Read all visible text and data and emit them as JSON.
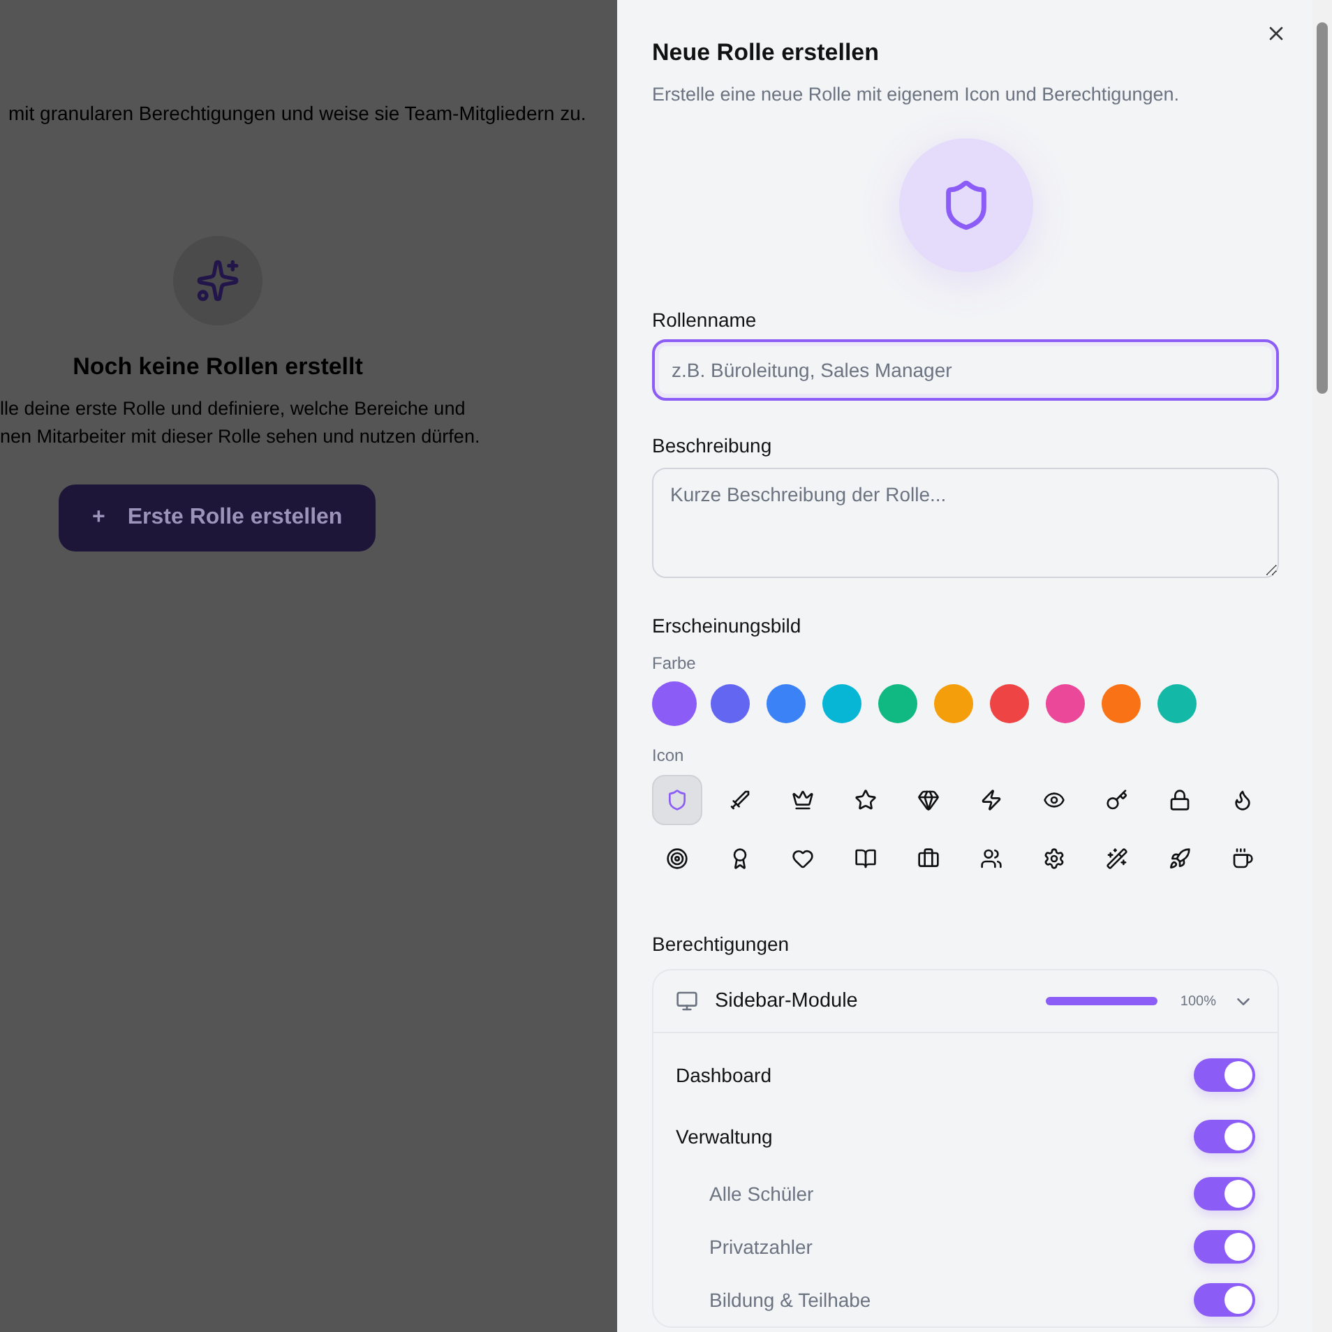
{
  "background_page": {
    "intro": "mit granularen Berechtigungen und weise sie Team-Mitgliedern zu.",
    "empty_state": {
      "title": "Noch keine Rollen erstellt",
      "text_lines": [
        "lle deine erste Rolle und definiere, welche Bereiche und",
        "nen Mitarbeiter mit dieser Rolle sehen und nutzen dürfen."
      ],
      "button": {
        "icon_text": "+",
        "label": "Erste Rolle erstellen"
      }
    }
  },
  "dialog": {
    "title": "Neue Rolle erstellen",
    "subtitle": "Erstelle eine neue Rolle mit eigenem Icon und Berechtigungen.",
    "name_field": {
      "label": "Rollenname",
      "placeholder": "z.B. Büroleitung, Sales Manager",
      "focused": true
    },
    "description_field": {
      "label": "Beschreibung",
      "placeholder": "Kurze Beschreibung der Rolle..."
    },
    "appearance": {
      "title": "Erscheinungsbild",
      "color_label": "Farbe",
      "colors": [
        {
          "color": "#8b5cf6",
          "selected": true
        },
        {
          "color": "#6366f1",
          "selected": false
        },
        {
          "color": "#3b82f6",
          "selected": false
        },
        {
          "color": "#06b6d4",
          "selected": false
        },
        {
          "color": "#10b981",
          "selected": false
        },
        {
          "color": "#f59e0b",
          "selected": false
        },
        {
          "color": "#ef4444",
          "selected": false
        },
        {
          "color": "#ec4899",
          "selected": false
        },
        {
          "color": "#f97316",
          "selected": false
        },
        {
          "color": "#14b8a6",
          "selected": false
        }
      ],
      "icon_label": "Icon",
      "icons": [
        {
          "selected": true
        },
        {
          "selected": false
        },
        {
          "selected": false
        },
        {
          "selected": false
        },
        {
          "selected": false
        },
        {
          "selected": false
        },
        {
          "selected": false
        },
        {
          "selected": false
        },
        {
          "selected": false
        },
        {
          "selected": false
        },
        {
          "selected": false
        },
        {
          "selected": false
        },
        {
          "selected": false
        },
        {
          "selected": false
        },
        {
          "selected": false
        },
        {
          "selected": false
        },
        {
          "selected": false
        },
        {
          "selected": false
        },
        {
          "selected": false
        },
        {
          "selected": false
        }
      ]
    },
    "permissions": {
      "title": "Berechtigungen",
      "groups": [
        {
          "title": "Sidebar-Module",
          "level": 1,
          "reading": "100%",
          "expanded": true,
          "items": [
            {
              "label": "Dashboard",
              "on": true
            },
            {
              "label": "Verwaltung",
              "on": true,
              "children": [
                {
                  "label": "Alle Schüler",
                  "on": true
                },
                {
                  "label": "Privatzahler",
                  "on": true
                },
                {
                  "label": "Bildung & Teilhabe",
                  "on": true
                }
              ]
            }
          ]
        }
      ]
    }
  }
}
